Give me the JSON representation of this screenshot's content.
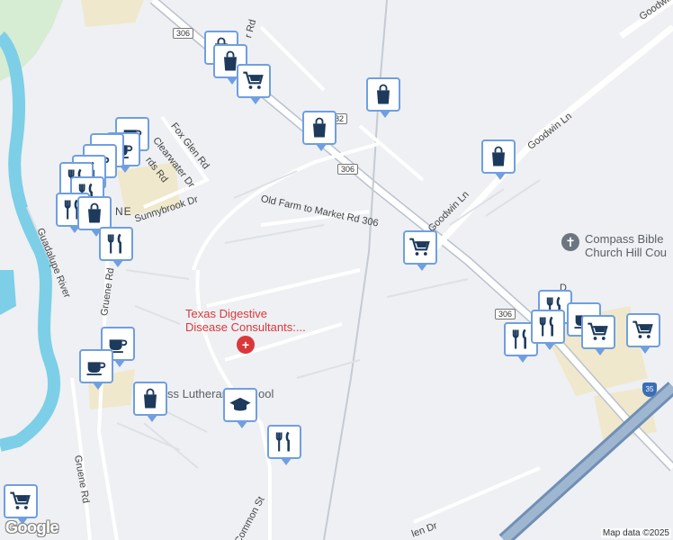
{
  "map": {
    "labels": {
      "goodwin_ln_1": "Goodwin Ln",
      "goodwin_ln_2": "Goodwin Ln",
      "goodwin_ln_3": "Goodwin",
      "fox_glen": "Fox Glen Rd",
      "clearwater": "Clearwater Dr",
      "rds_rd": "rds Rd",
      "sunnybrook": "Sunnybrook Dr",
      "old_farm": "Old Farm to Market Rd 306",
      "gruene_rd_1": "Gruene Rd",
      "gruene_rd_2": "Gruene Rd",
      "guadalupe": "Guadalupe River",
      "common_st": "Common St",
      "len_dr": "len Dr",
      "rd_top": "r Rd",
      "ne": "NE",
      "dr_right": "D"
    },
    "pois": {
      "texas_digestive_1": "Texas Digestive",
      "texas_digestive_2": "Disease Consultants:...",
      "compass_1": "Compass Bible",
      "compass_2": "Church Hill Cou",
      "lutheran_1": "ss Lutheran",
      "lutheran_2": "ool"
    },
    "shields": {
      "s306_top": "306",
      "s306_mid": "306",
      "s306_right": "306",
      "s_82": "82",
      "i35": "35"
    },
    "google_logo": "Google",
    "attribution": "Map data ©2025",
    "pin_color": "#6f9fe0",
    "icon_color": "#1d3a5c"
  }
}
